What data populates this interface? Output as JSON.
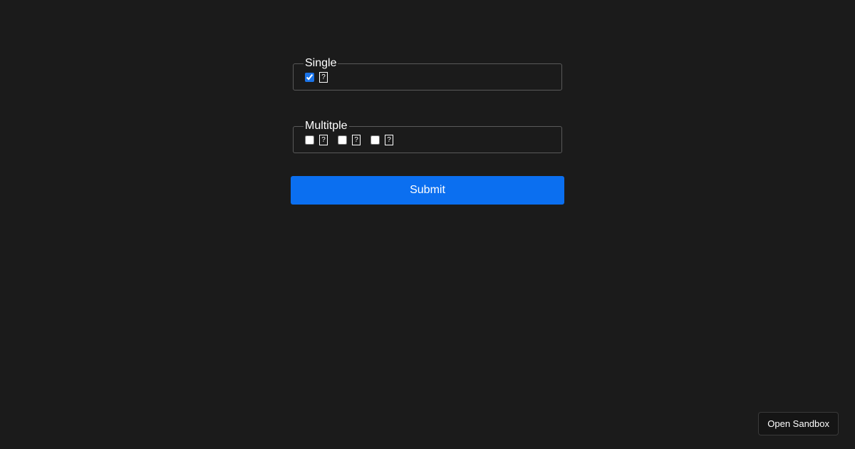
{
  "form": {
    "single": {
      "legend": "Single",
      "options": [
        {
          "glyph": "?",
          "checked": true
        }
      ]
    },
    "multiple": {
      "legend": "Multitple",
      "options": [
        {
          "glyph": "?",
          "checked": false
        },
        {
          "glyph": "?",
          "checked": false
        },
        {
          "glyph": "?",
          "checked": false
        }
      ]
    },
    "submit_label": "Submit"
  },
  "sandbox": {
    "label": "Open Sandbox"
  },
  "colors": {
    "background": "#1b1b1b",
    "accent": "#0b6ff0"
  }
}
